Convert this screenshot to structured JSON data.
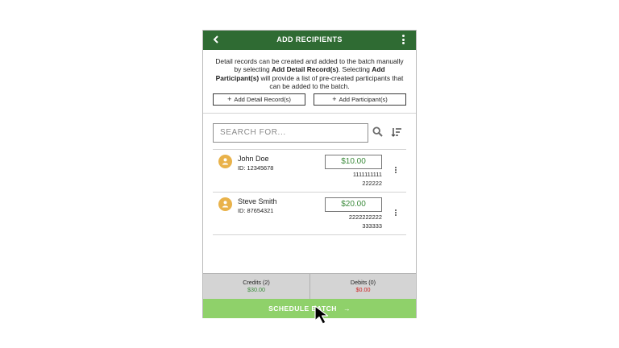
{
  "header": {
    "title": "ADD RECIPIENTS",
    "back_icon": "chevron-left-icon",
    "menu_icon": "kebab-menu-icon"
  },
  "intro": {
    "part1": "Detail records can be created and added to the batch manually by selecting ",
    "bold1": "Add Detail Record(s)",
    "part2": ". Selecting ",
    "bold2": "Add Participant(s)",
    "part3": " will provide a list of pre-created participants that can be added to the batch."
  },
  "actions": {
    "add_detail_label": "Add Detail Record(s)",
    "add_participant_label": "Add Participant(s)",
    "plus": "+"
  },
  "search": {
    "placeholder": "SEARCH FOR...",
    "search_icon": "search-icon",
    "sort_icon": "sort-icon"
  },
  "recipients": [
    {
      "name": "John Doe",
      "id": "ID: 12345678",
      "amount": "$10.00",
      "account1": "1111111111",
      "account2": "222222"
    },
    {
      "name": "Steve Smith",
      "id": "ID: 87654321",
      "amount": "$20.00",
      "account1": "2222222222",
      "account2": "333333"
    }
  ],
  "summary": {
    "credits_label": "Credits (2)",
    "credits_value": "$30.00",
    "debits_label": "Debits (0)",
    "debits_value": "$0.00"
  },
  "schedule": {
    "label": "SCHEDULE BATCH",
    "arrow": "→"
  },
  "colors": {
    "header_bg": "#2f6b33",
    "schedule_bg": "#8fd16a",
    "credit": "#3a8a3a",
    "debit": "#cc2222",
    "avatar": "#e9b24a"
  }
}
